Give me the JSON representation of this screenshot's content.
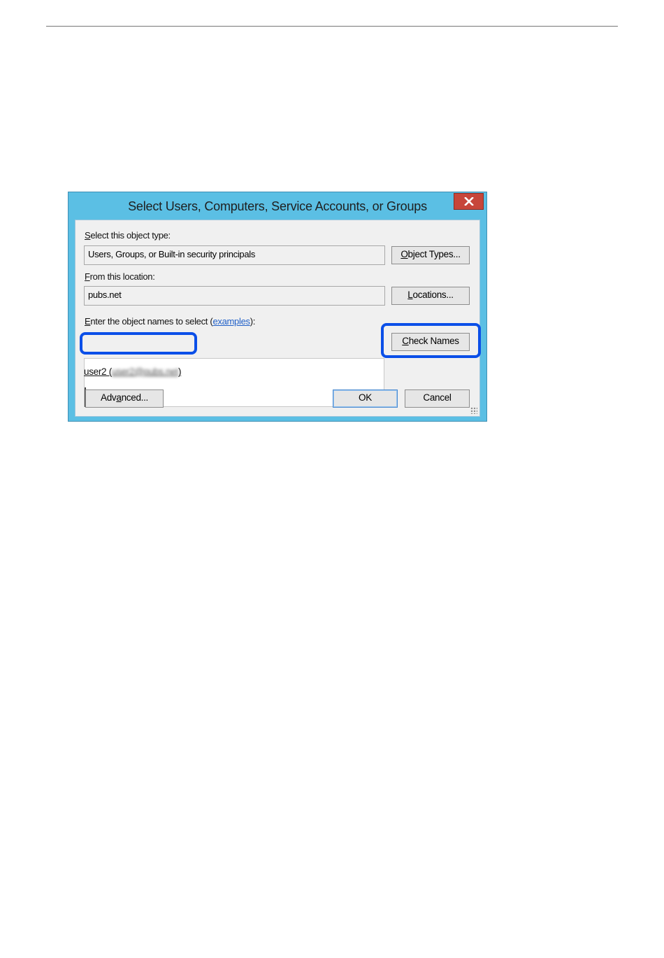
{
  "dialog": {
    "title": "Select Users, Computers, Service Accounts, or Groups",
    "close_icon": "close-icon",
    "object_type": {
      "label_first": "S",
      "label_rest": "elect this object type:",
      "value": "Users, Groups, or Built-in security principals",
      "button_first": "O",
      "button_rest": "bject Types..."
    },
    "location": {
      "label_first": "F",
      "label_rest": "rom this location:",
      "value": "pubs.net",
      "button_first": "L",
      "button_rest": "ocations..."
    },
    "names": {
      "label_first": "E",
      "label_rest": "nter the object names to select (",
      "link": "examples",
      "label_end": "):",
      "entry_prefix": "user2 (",
      "entry_blurred": "user2@pubs.net",
      "entry_suffix": ")",
      "check_first": "C",
      "check_rest": "heck Names"
    },
    "buttons": {
      "advanced_pre": "Adv",
      "advanced_ul": "a",
      "advanced_post": "nced...",
      "ok": "OK",
      "cancel": "Cancel"
    }
  },
  "colors": {
    "highlight": "#0b4fe8",
    "titlebar": "#5bbfe4",
    "close": "#c7463a",
    "link": "#2060c8"
  }
}
